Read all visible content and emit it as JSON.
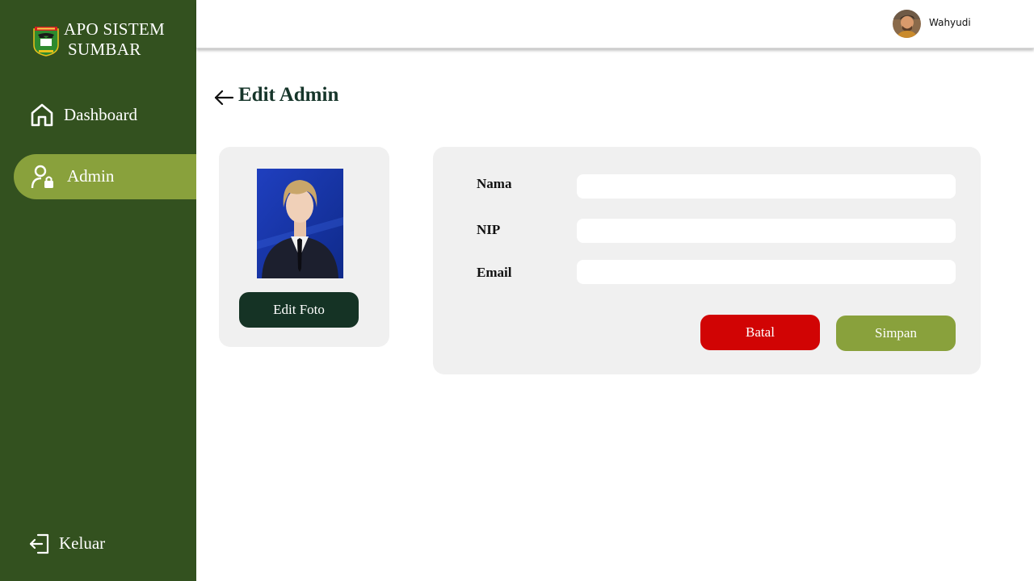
{
  "sidebar": {
    "brand_line1": "APO SISTEM",
    "brand_line2": "SUMBAR",
    "logo_icon": "west-sumatra-crest-icon",
    "items": [
      {
        "label": "Dashboard",
        "icon": "home-icon",
        "active": false
      },
      {
        "label": "Admin",
        "icon": "user-lock-icon",
        "active": true
      }
    ],
    "logout_label": "Keluar",
    "logout_icon": "logout-icon"
  },
  "topbar": {
    "username": "Wahyudi",
    "avatar_icon": "user-avatar"
  },
  "page": {
    "title": "Edit Admin",
    "back_icon": "arrow-left-icon"
  },
  "photo_card": {
    "edit_label": "Edit Foto"
  },
  "form": {
    "fields": [
      {
        "label": "Nama",
        "value": "",
        "placeholder": ""
      },
      {
        "label": "NIP",
        "value": "",
        "placeholder": ""
      },
      {
        "label": "Email",
        "value": "",
        "placeholder": ""
      }
    ],
    "cancel_label": "Batal",
    "save_label": "Simpan"
  },
  "colors": {
    "sidebar_bg": "#33511f",
    "active_item": "#89a13c",
    "title_color": "#16352a",
    "edit_photo_btn": "#153325",
    "cancel_btn": "#d10404",
    "save_btn": "#89a13c",
    "card_bg": "#f0f0f0"
  }
}
